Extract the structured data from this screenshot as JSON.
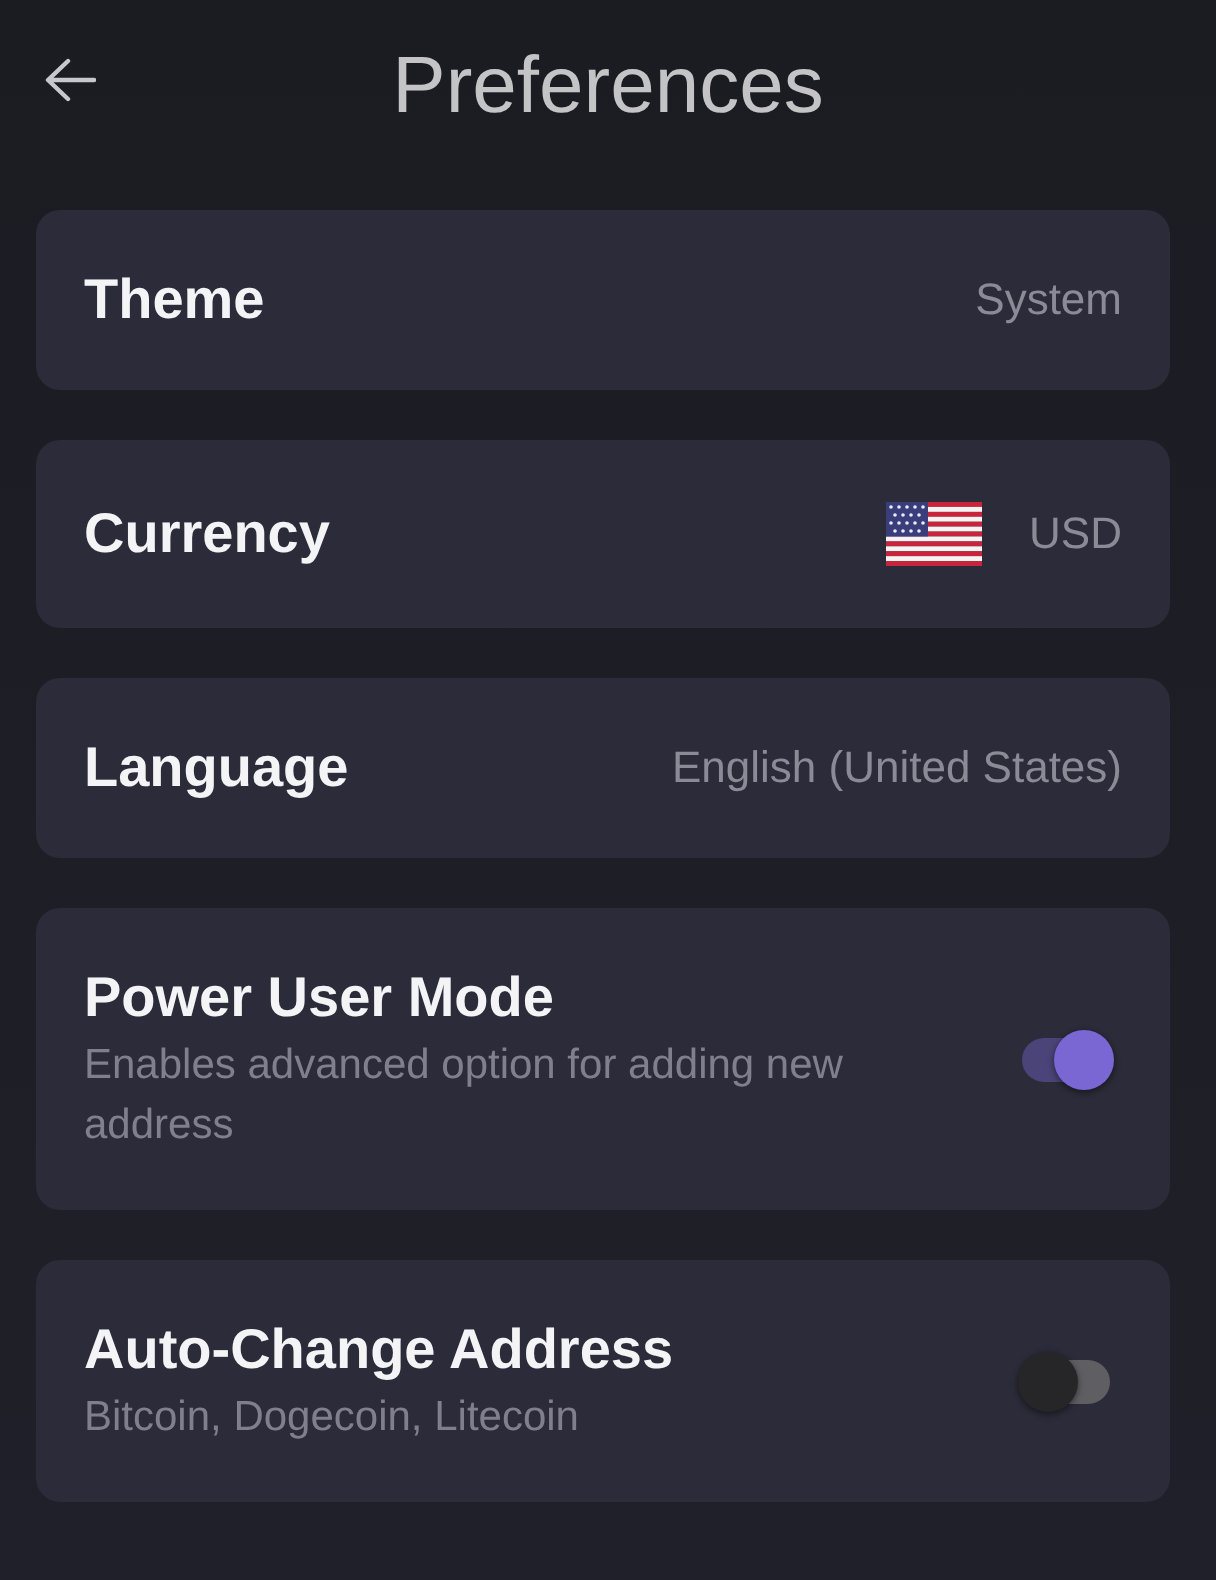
{
  "header": {
    "title": "Preferences"
  },
  "settings": [
    {
      "kind": "value",
      "label": "Theme",
      "value": "System"
    },
    {
      "kind": "flag-value",
      "label": "Currency",
      "value": "USD"
    },
    {
      "kind": "value",
      "label": "Language",
      "value": "English (United States)"
    },
    {
      "kind": "toggle",
      "label": "Power User Mode",
      "description": "Enables advanced option for adding new address",
      "on": true
    },
    {
      "kind": "toggle",
      "label": "Auto-Change Address",
      "description": "Bitcoin, Dogecoin, Litecoin",
      "on": false
    }
  ]
}
